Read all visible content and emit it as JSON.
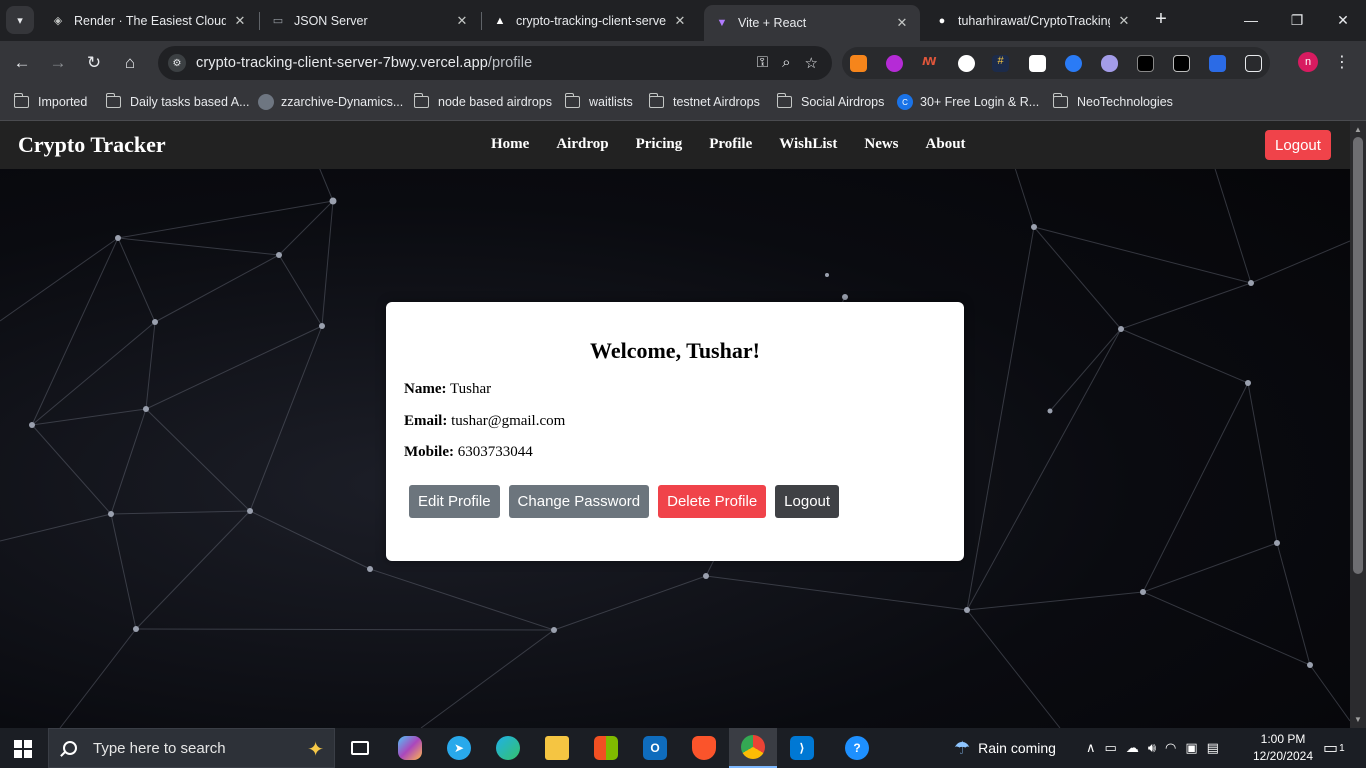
{
  "browser": {
    "tabs": [
      {
        "title": "Render · The Easiest Cloud For",
        "active": false
      },
      {
        "title": "JSON Server",
        "active": false
      },
      {
        "title": "crypto-tracking-client-server",
        "active": false
      },
      {
        "title": "Vite + React",
        "active": true
      },
      {
        "title": "tuharhirawat/CryptoTracking",
        "active": false
      }
    ],
    "url_domain": "crypto-tracking-client-server-7bwy.vercel.app",
    "url_path": "/profile",
    "profile_initial": "n",
    "bookmarks": [
      "Imported",
      "Daily tasks based A...",
      "zzarchive-Dynamics...",
      "node based airdrops",
      "waitlists",
      "testnet Airdrops",
      "Social Airdrops",
      "30+ Free Login & R...",
      "NeoTechnologies"
    ]
  },
  "site": {
    "brand": "Crypto Tracker",
    "menu": [
      "Home",
      "Airdrop",
      "Pricing",
      "Profile",
      "WishList",
      "News",
      "About"
    ],
    "logout_label": "Logout"
  },
  "profile": {
    "heading": "Welcome, Tushar!",
    "name_label": "Name:",
    "name": "Tushar",
    "email_label": "Email:",
    "email": "tushar@gmail.com",
    "mobile_label": "Mobile:",
    "mobile": "6303733044",
    "buttons": {
      "edit": "Edit Profile",
      "change_password": "Change Password",
      "delete": "Delete Profile",
      "logout": "Logout"
    }
  },
  "colors": {
    "danger": "#f0434a",
    "secondary": "#6c757d",
    "dark": "#343a40",
    "nav_bg": "#222222"
  },
  "taskbar": {
    "search_placeholder": "Type here to search",
    "weather": "Rain coming",
    "time": "1:00 PM",
    "date": "12/20/2024",
    "notification_count": "1"
  }
}
